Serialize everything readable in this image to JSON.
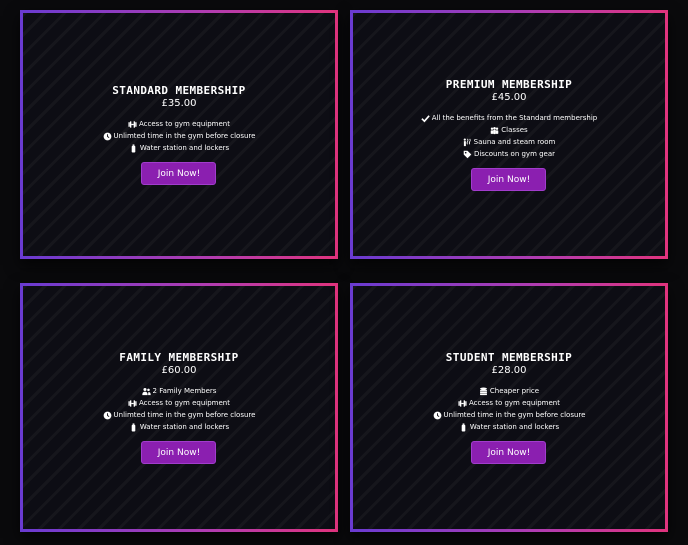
{
  "plans": [
    {
      "title": "Standard Membership",
      "price": "£35.00",
      "features": [
        {
          "icon": "dumbbell-icon",
          "text": "Access to gym equipment"
        },
        {
          "icon": "clock-icon",
          "text": "Unlimted time in the gym before closure"
        },
        {
          "icon": "bottle-icon",
          "text": "Water station and lockers"
        }
      ],
      "button": "Join Now!"
    },
    {
      "title": "Premium Membership",
      "price": "£45.00",
      "features": [
        {
          "icon": "check-icon",
          "text": "All the benefits from the Standard membership"
        },
        {
          "icon": "people-group-icon",
          "text": "Classes"
        },
        {
          "icon": "hot-tub-icon",
          "text": "Sauna and steam room"
        },
        {
          "icon": "tag-icon",
          "text": "Discounts on gym gear"
        }
      ],
      "button": "Join Now!"
    },
    {
      "title": "Family Membership",
      "price": "£60.00",
      "features": [
        {
          "icon": "users-icon",
          "text": "2 Family Members"
        },
        {
          "icon": "dumbbell-icon",
          "text": "Access to gym equipment"
        },
        {
          "icon": "clock-icon",
          "text": "Unlimted time in the gym before closure"
        },
        {
          "icon": "bottle-icon",
          "text": "Water station and lockers"
        }
      ],
      "button": "Join Now!"
    },
    {
      "title": "Student Membership",
      "price": "£28.00",
      "features": [
        {
          "icon": "coins-icon",
          "text": "Cheaper price"
        },
        {
          "icon": "dumbbell-icon",
          "text": "Access to gym equipment"
        },
        {
          "icon": "clock-icon",
          "text": "Unlimted time in the gym before closure"
        },
        {
          "icon": "bottle-icon",
          "text": "Water station and lockers"
        }
      ],
      "button": "Join Now!"
    }
  ],
  "colors": {
    "accent": "#8b1fb0",
    "border_start": "#6a3bd1",
    "border_end": "#e0347e",
    "background": "#0a0a0c"
  }
}
